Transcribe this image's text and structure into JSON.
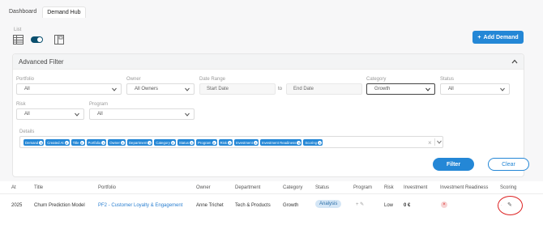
{
  "tabs": [
    {
      "label": "Dashboard"
    },
    {
      "label": "Demand Hub"
    }
  ],
  "view": {
    "label": "List"
  },
  "actions": {
    "add_label": "Add Demand",
    "add_icon": "plus-icon"
  },
  "filter": {
    "title": "Advanced Filter",
    "portfolio": {
      "label": "Portfolio",
      "value": "All"
    },
    "owner": {
      "label": "Owner",
      "value": "All Owners"
    },
    "date_range": {
      "label": "Date Range",
      "start_placeholder": "Start Date",
      "to_label": "to",
      "end_placeholder": "End Date"
    },
    "category": {
      "label": "Category",
      "value": "Growth"
    },
    "status": {
      "label": "Status",
      "value": "All"
    },
    "risk": {
      "label": "Risk",
      "value": "All"
    },
    "program": {
      "label": "Program",
      "value": "All"
    },
    "details": {
      "label": "Details",
      "chips": [
        "Demand",
        "Created At",
        "Title",
        "Portfolio",
        "Owner",
        "Department",
        "Category",
        "Status",
        "Program",
        "Risk",
        "Investment",
        "Investment Readiness",
        "Scoring"
      ]
    },
    "filter_label": "Filter",
    "clear_label": "Clear"
  },
  "table": {
    "columns": [
      "At",
      "Title",
      "Portfolio",
      "Owner",
      "Department",
      "Category",
      "Status",
      "Program",
      "Risk",
      "Investment",
      "Investment Readiness",
      "Scoring"
    ],
    "row": {
      "date": "2025",
      "title": "Churn Prediction Model",
      "portfolio": "PF2 - Customer Loyalty & Engagement",
      "owner": "Anne Trichet",
      "department": "Tech & Products",
      "category": "Growth",
      "status": "Analysis",
      "program_icons": "+ ✎",
      "risk": "Low",
      "investment": "0 €",
      "investment_readiness": "×",
      "scoring_icon": "pencil-icon"
    }
  },
  "colors": {
    "accent": "#2487d6",
    "toggle": "#0a4f6e",
    "highlight": "#dd2222"
  }
}
